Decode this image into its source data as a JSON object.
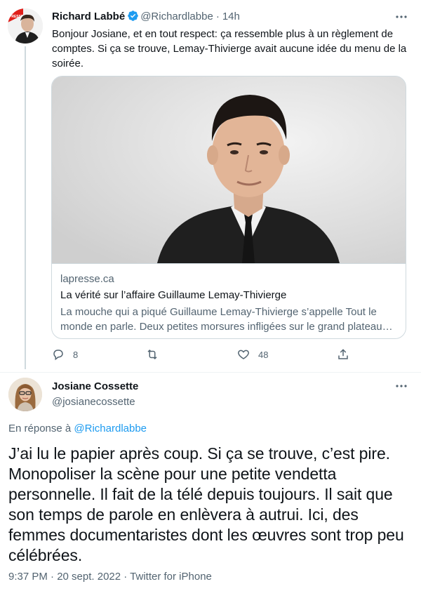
{
  "tweet1": {
    "author_name": "Richard Labbé",
    "author_handle": "@Richardlabbe",
    "separator": "·",
    "time": "14h",
    "avatar_badge": "LA PRESSE",
    "text": "Bonjour Josiane, et en tout respect: ça ressemble plus à un règlement de comptes. Si ça se trouve, Lemay-Thivierge avait aucune idée du menu de la soirée.",
    "card": {
      "domain": "lapresse.ca",
      "title": "La vérité sur l’affaire Guillaume Lemay-Thivierge",
      "description": "La mouche qui a piqué Guillaume Lemay-Thivierge s’appelle Tout le monde en parle. Deux petites morsures infligées sur le grand plateau…"
    },
    "actions": {
      "reply_count": "8",
      "retweet_count": "",
      "like_count": "48"
    }
  },
  "tweet2": {
    "author_name": "Josiane Cossette",
    "author_handle": "@josianecossette",
    "reply_prefix": "En réponse à",
    "reply_to": "@Richardlabbe",
    "text": "J’ai lu le papier après coup. Si ça se trouve, c’est pire. Monopoliser la scène pour une petite vendetta personnelle. Il fait de la télé depuis toujours. Il sait que son temps de parole en enlèvera à autrui. Ici, des femmes documentaristes dont les œuvres sont trop peu célébrées.",
    "meta": "9:37 PM · 20 sept. 2022 · Twitter for iPhone"
  },
  "colors": {
    "accent": "#1d9bf0",
    "muted": "#536471",
    "text": "#0f1419",
    "border": "#cfd9de",
    "badge_red": "#e0201b"
  }
}
